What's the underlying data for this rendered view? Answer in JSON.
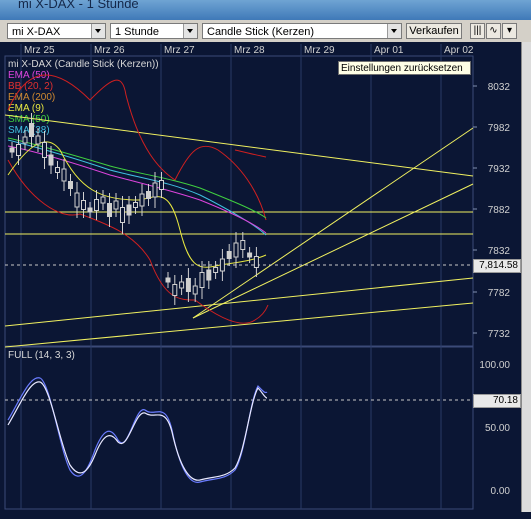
{
  "window": {
    "title": "mi X-DAX - 1 Stunde"
  },
  "toolbar": {
    "instrument": "mi X-DAX",
    "interval": "1 Stunde",
    "chart_type": "Candle Stick (Kerzen)",
    "sell_label": "Verkaufen"
  },
  "dates": [
    "Mrz 25",
    "Mrz 26",
    "Mrz 27",
    "Mrz 28",
    "Mrz 29",
    "Apr 01",
    "Apr 02"
  ],
  "legend": [
    {
      "label": "mi X-DAX (Candle Stick (Kerzen))",
      "color": "#d8d8d8"
    },
    {
      "label": "EMA (50)",
      "color": "#dd44dd"
    },
    {
      "label": "BB (20, 2)",
      "color": "#e03030"
    },
    {
      "label": "EMA (200)",
      "color": "#d08a30"
    },
    {
      "label": "EMA (9)",
      "color": "#e8e840"
    },
    {
      "label": "SMA (50)",
      "color": "#40d040"
    },
    {
      "label": "SMA (38)",
      "color": "#40c0e0"
    }
  ],
  "tooltip": "Einstellungen zurücksetzen",
  "price_axis": [
    "8032",
    "7982",
    "7932",
    "7882",
    "7832",
    "7782",
    "7732"
  ],
  "current_price": "7,814.58",
  "oscillator": {
    "label": "FULL (14, 3, 3)",
    "axis": [
      "100.00",
      "50.00",
      "0.00"
    ],
    "current": "70.18"
  },
  "colors": {
    "background": "#0b1634",
    "grid": "#2a3a66",
    "trendline": "#f0f060"
  }
}
